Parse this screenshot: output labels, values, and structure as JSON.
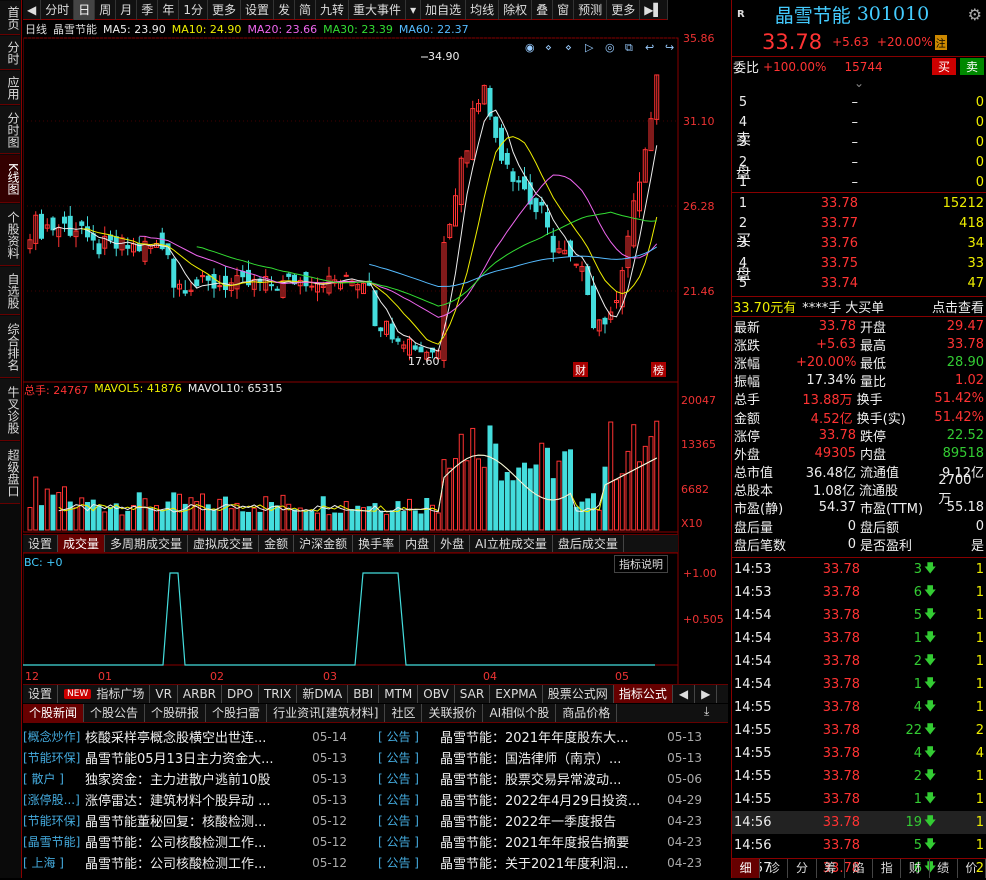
{
  "left_nav": [
    "首页",
    "分时",
    "应用",
    "分时图",
    "K线图",
    "个股资料",
    "自选股",
    "综合排名",
    "牛叉诊股",
    "超级盘口"
  ],
  "top_toolbar": [
    "分时",
    "日",
    "周",
    "月",
    "季",
    "年",
    "1分",
    "更多",
    "设置",
    "发",
    "简",
    "九转",
    "重大事件",
    "加自选",
    "均线",
    "除权",
    "叠",
    "窗",
    "预测",
    "更多"
  ],
  "ma_line": {
    "period": "日线",
    "stock": "晶雪节能",
    "ma5": "MA5: 23.90",
    "ma10": "MA10: 24.90",
    "ma20": "MA20: 23.66",
    "ma30": "MA30: 23.39",
    "ma60": "MA60: 22.37"
  },
  "price_axis": [
    "35.86",
    "31.10",
    "26.28",
    "21.46"
  ],
  "price_marks": {
    "high": "34.90",
    "low": "17.60",
    "cai": "财",
    "bang": "榜"
  },
  "volume_line": {
    "total": "总手: 24767",
    "mavol5": "MAVOL5: 41876",
    "mavol10": "MAVOL10: 65315"
  },
  "volume_axis": [
    "20047",
    "13365",
    "6682",
    "X10"
  ],
  "indicator_tabs": [
    "设置",
    "成交量",
    "多周期成交量",
    "虚拟成交量",
    "金额",
    "沪深金额",
    "换手率",
    "内盘",
    "外盘",
    "AI立桩成交量",
    "盘后成交量"
  ],
  "bc_label": "BC: +0",
  "bc_axis": [
    "+1.00",
    "+0.505"
  ],
  "indicator_explain": "指标说明",
  "months": [
    "12",
    "01",
    "02",
    "03",
    "04",
    "05"
  ],
  "formula_tabs": [
    "设置",
    "NEW",
    "指标广场",
    "VR",
    "ARBR",
    "DPO",
    "TRIX",
    "新DMA",
    "BBI",
    "MTM",
    "OBV",
    "SAR",
    "EXPMA",
    "股票公式网",
    "指标公式"
  ],
  "news_tabs": [
    "个股新闻",
    "个股公告",
    "个股研报",
    "个股扫雷",
    "行业资讯[建筑材料]",
    "社区",
    "关联报价",
    "AI相似个股",
    "商品价格"
  ],
  "news_left": [
    {
      "cat": "[概念炒作]",
      "title": "核酸采样亭概念股横空出世连...",
      "date": "05-14"
    },
    {
      "cat": "[节能环保]",
      "title": "晶雪节能05月13日主力资金大...",
      "date": "05-13"
    },
    {
      "cat": "[ 散户 ]",
      "title": "独家资金：主力进散户逃前10股",
      "date": "05-13"
    },
    {
      "cat": "[涨停股...]",
      "title": "涨停雷达：建筑材料个股异动 ...",
      "date": "05-13"
    },
    {
      "cat": "[节能环保]",
      "title": "晶雪节能董秘回复：核酸检测...",
      "date": "05-12"
    },
    {
      "cat": "[晶雪节能]",
      "title": "晶雪节能：公司核酸检测工作...",
      "date": "05-12"
    },
    {
      "cat": "[ 上海 ]",
      "title": "晶雪节能：公司核酸检测工作...",
      "date": "05-12"
    }
  ],
  "news_right": [
    {
      "cat": "[ 公告 ]",
      "title": "晶雪节能：2021年年度股东大...",
      "date": "05-13"
    },
    {
      "cat": "[ 公告 ]",
      "title": "晶雪节能：国浩律师（南京）...",
      "date": "05-13"
    },
    {
      "cat": "[ 公告 ]",
      "title": "晶雪节能：股票交易异常波动...",
      "date": "05-06"
    },
    {
      "cat": "[ 公告 ]",
      "title": "晶雪节能：2022年4月29日投资...",
      "date": "04-29"
    },
    {
      "cat": "[ 公告 ]",
      "title": "晶雪节能：2022年一季度报告",
      "date": "04-23"
    },
    {
      "cat": "[ 公告 ]",
      "title": "晶雪节能：2021年年度报告摘要",
      "date": "04-23"
    },
    {
      "cat": "[ 公告 ]",
      "title": "晶雪节能：关于2021年度利润...",
      "date": "04-23"
    }
  ],
  "header": {
    "badge": "R",
    "name": "晶雪节能",
    "code": "301010",
    "price": "33.78",
    "change": "+5.63",
    "pct": "+20.00%",
    "zhu": "注"
  },
  "weibi": {
    "label": "委比",
    "pct": "+100.00%",
    "diff": "15744",
    "buy": "买",
    "sell": "卖"
  },
  "sell_orders": [
    {
      "lvl": "5",
      "price": "–",
      "vol": "0"
    },
    {
      "lvl": "4",
      "price": "–",
      "vol": "0"
    },
    {
      "lvl": "3",
      "price": "–",
      "vol": "0"
    },
    {
      "lvl": "2",
      "price": "–",
      "vol": "0"
    },
    {
      "lvl": "1",
      "price": "–",
      "vol": "0"
    }
  ],
  "sell_label": [
    "卖",
    "盘"
  ],
  "buy_orders": [
    {
      "lvl": "1",
      "price": "33.78",
      "vol": "15212"
    },
    {
      "lvl": "2",
      "price": "33.77",
      "vol": "418"
    },
    {
      "lvl": "3",
      "price": "33.76",
      "vol": "34"
    },
    {
      "lvl": "4",
      "price": "33.75",
      "vol": "33"
    },
    {
      "lvl": "5",
      "price": "33.74",
      "vol": "47"
    }
  ],
  "buy_label": [
    "买",
    "盘"
  ],
  "big_order": {
    "price": "33.70元有",
    "mask": "****手",
    "type": "大买单",
    "link": "点击查看"
  },
  "stats": [
    [
      "最新",
      "33.78",
      "开盘",
      "29.47"
    ],
    [
      "涨跌",
      "+5.63",
      "最高",
      "33.78"
    ],
    [
      "涨幅",
      "+20.00%",
      "最低",
      "28.90"
    ],
    [
      "振幅",
      "17.34%",
      "量比",
      "1.02"
    ],
    [
      "总手",
      "13.88万",
      "换手",
      "51.42%"
    ],
    [
      "金额",
      "4.52亿",
      "换手(实)",
      "51.42%"
    ],
    [
      "涨停",
      "33.78",
      "跌停",
      "22.52"
    ],
    [
      "外盘",
      "49305",
      "内盘",
      "89518"
    ],
    [
      "总市值",
      "36.48亿",
      "流通值",
      "9.12亿"
    ],
    [
      "总股本",
      "1.08亿",
      "流通股",
      "2700万"
    ],
    [
      "市盈(静)",
      "54.37",
      "市盈(TTM)",
      "55.18"
    ],
    [
      "盘后量",
      "0",
      "盘后额",
      "0"
    ],
    [
      "盘后笔数",
      "0",
      "是否盈利",
      "是"
    ]
  ],
  "ticks": [
    {
      "t": "14:53",
      "p": "33.78",
      "v": "3",
      "n": "1"
    },
    {
      "t": "14:53",
      "p": "33.78",
      "v": "6",
      "n": "1"
    },
    {
      "t": "14:54",
      "p": "33.78",
      "v": "5",
      "n": "1"
    },
    {
      "t": "14:54",
      "p": "33.78",
      "v": "1",
      "n": "1"
    },
    {
      "t": "14:54",
      "p": "33.78",
      "v": "2",
      "n": "1"
    },
    {
      "t": "14:54",
      "p": "33.78",
      "v": "1",
      "n": "1"
    },
    {
      "t": "14:55",
      "p": "33.78",
      "v": "4",
      "n": "1"
    },
    {
      "t": "14:55",
      "p": "33.78",
      "v": "22",
      "n": "2"
    },
    {
      "t": "14:55",
      "p": "33.78",
      "v": "4",
      "n": "4"
    },
    {
      "t": "14:55",
      "p": "33.78",
      "v": "2",
      "n": "1"
    },
    {
      "t": "14:55",
      "p": "33.78",
      "v": "1",
      "n": "1"
    },
    {
      "t": "14:56",
      "p": "33.78",
      "v": "19",
      "n": "1"
    },
    {
      "t": "14:56",
      "p": "33.78",
      "v": "5",
      "n": "1"
    },
    {
      "t": "14:57",
      "p": "33.78",
      "v": "6",
      "n": "2"
    }
  ],
  "right_tabs": [
    "细",
    "诊",
    "分",
    "筹",
    "焰",
    "指",
    "财",
    "绩",
    "价"
  ]
}
